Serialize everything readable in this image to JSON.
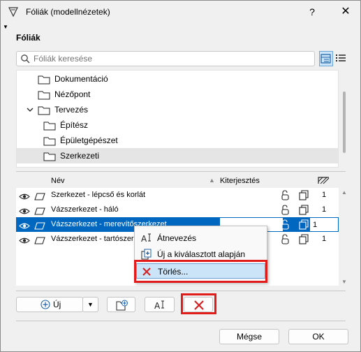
{
  "window": {
    "title": "Fóliák (modellnézetek)",
    "help_label": "?",
    "close_label": "✕"
  },
  "section": {
    "label": "Fóliák"
  },
  "search": {
    "placeholder": "Fóliák keresése"
  },
  "tree": {
    "items": [
      {
        "label": "Dokumentáció",
        "level": 0
      },
      {
        "label": "Nézőpont",
        "level": 0
      },
      {
        "label": "Tervezés",
        "level": 0,
        "expanded": true
      },
      {
        "label": "Építész",
        "level": 1
      },
      {
        "label": "Épületgépészet",
        "level": 1
      },
      {
        "label": "Szerkezeti",
        "level": 1,
        "selected": true
      }
    ]
  },
  "grid": {
    "headers": {
      "name": "Név",
      "extent": "Kiterjesztés"
    },
    "rows": [
      {
        "name": "Szerkezet - lépcső és korlát",
        "value": "1"
      },
      {
        "name": "Vázszerkezet - háló",
        "value": "1"
      },
      {
        "name": "Vázszerkezet - merevítőszerkezet",
        "value": "1",
        "selected": true
      },
      {
        "name": "Vázszerkezet - tartószerkezet",
        "value": "1"
      }
    ]
  },
  "context_menu": {
    "items": [
      {
        "label": "Átnevezés",
        "icon": "rename-icon"
      },
      {
        "label": "Új a kiválasztott alapján",
        "icon": "new-from-selected-icon"
      },
      {
        "label": "Törlés...",
        "icon": "delete-icon",
        "highlighted": true
      }
    ]
  },
  "toolbar": {
    "new_label": "Új"
  },
  "footer": {
    "cancel_label": "Mégse",
    "ok_label": "OK"
  },
  "colors": {
    "selection_blue": "#0067c0",
    "highlight_red": "#e21b1b",
    "delete_red": "#d42020"
  }
}
